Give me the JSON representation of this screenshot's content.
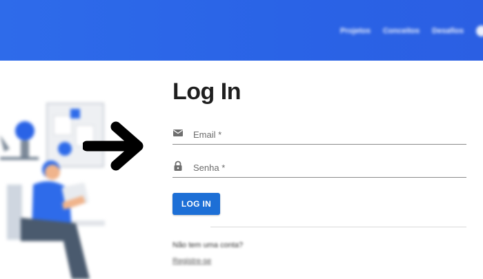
{
  "header": {
    "nav": [
      "Projetos",
      "Conceitos",
      "Desafios"
    ]
  },
  "login": {
    "title": "Log In",
    "email_placeholder": "Email *",
    "password_placeholder": "Senha *",
    "submit_label": "LOG IN",
    "signup_prompt": "Não tem uma conta?",
    "signup_link": "Registre-se"
  },
  "icons": {
    "email": "envelope-icon",
    "password": "lock-icon",
    "arrow": "arrow-right-icon"
  },
  "colors": {
    "header": "#2a63e6",
    "button": "#1d6fd6"
  }
}
